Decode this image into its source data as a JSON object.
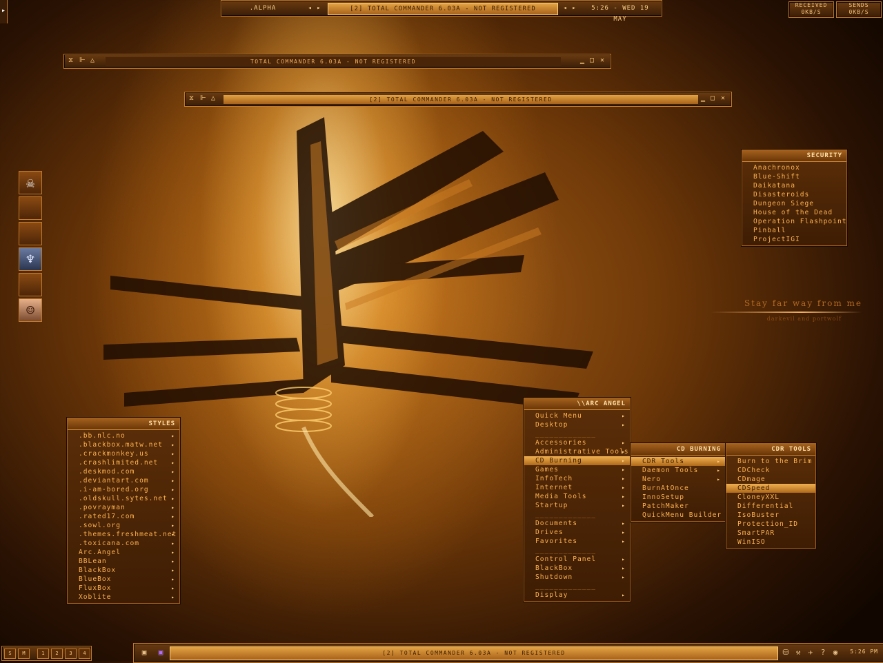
{
  "top_bar": {
    "workspace": ".ALPHA",
    "nav_prev": "◂ ▸",
    "window_title": "[2] TOTAL COMMANDER 6.03A - NOT REGISTERED",
    "nav_next": "◂ ▸",
    "clock": "5:26 - WED 19 MAY"
  },
  "net_monitor": {
    "received_label": "RECEIVED",
    "received_value": "0KB/S",
    "sends_label": "SENDS",
    "sends_value": "0KB/S"
  },
  "windows": [
    {
      "title": "TOTAL COMMANDER 6.03A - NOT REGISTERED"
    },
    {
      "title": "[2] TOTAL COMMANDER 6.03A - NOT REGISTERED"
    }
  ],
  "icon_bar": {
    "icons": [
      "skull-icon",
      "empty-slot",
      "empty-slot",
      "mask-icon",
      "empty-slot",
      "portrait-icon"
    ]
  },
  "security_menu": {
    "title": "SECURITY",
    "items": [
      "Anachronox",
      "Blue-Shift",
      "Daikatana",
      "Disasteroids",
      "Dungeon Siege",
      "House of the Dead",
      "Operation Flashpoint",
      "Pinball",
      "ProjectIGI"
    ]
  },
  "quote": {
    "line1": "Stay far way from me",
    "line2": "darkevil and portwolf"
  },
  "styles_menu": {
    "title": "STYLES",
    "items": [
      ".bb.nlc.no",
      ".blackbox.matw.net",
      ".crackmonkey.us",
      ".crashlimited.net",
      ".deskmod.com",
      ".deviantart.com",
      ".i-am-bored.org",
      ".oldskull.sytes.net",
      ".povrayman",
      ".rated17.com",
      ".sowl.org",
      ".themes.freshmeat.net",
      ".toxicana.com",
      "Arc.Angel",
      "BBLean",
      "BlackBox",
      "BlueBox",
      "FluxBox",
      "Xoblite"
    ]
  },
  "arc_menu": {
    "title": "\\\\ARC ANGEL",
    "items": [
      {
        "label": "Quick Menu",
        "sub": true
      },
      {
        "label": "Desktop",
        "sub": true
      },
      {
        "label": "_____________",
        "sep": true
      },
      {
        "label": "Accessories",
        "sub": true
      },
      {
        "label": "Administrative Tools",
        "sub": true
      },
      {
        "label": "CD Burning",
        "sub": true,
        "selected": true
      },
      {
        "label": "Games",
        "sub": true
      },
      {
        "label": "InfoTech",
        "sub": true
      },
      {
        "label": "Internet",
        "sub": true
      },
      {
        "label": "Media Tools",
        "sub": true
      },
      {
        "label": "Startup",
        "sub": true
      },
      {
        "label": "_____________",
        "sep": true
      },
      {
        "label": "Documents",
        "sub": true
      },
      {
        "label": "Drives",
        "sub": true
      },
      {
        "label": "Favorites",
        "sub": true
      },
      {
        "label": "_____________",
        "sep": true
      },
      {
        "label": "Control Panel",
        "sub": true
      },
      {
        "label": "BlackBox",
        "sub": true
      },
      {
        "label": "Shutdown",
        "sub": true
      },
      {
        "label": "_____________",
        "sep": true
      },
      {
        "label": "Display",
        "sub": true
      }
    ]
  },
  "cd_burning_menu": {
    "title": "CD BURNING",
    "items": [
      {
        "label": "CDR Tools",
        "sub": true,
        "selected": true
      },
      {
        "label": "Daemon Tools",
        "sub": true
      },
      {
        "label": "Nero",
        "sub": true
      },
      {
        "label": "BurnAtOnce"
      },
      {
        "label": "InnoSetup"
      },
      {
        "label": "PatchMaker"
      },
      {
        "label": "QuickMenu Builder"
      }
    ]
  },
  "cdr_tools_menu": {
    "title": "CDR TOOLS",
    "items": [
      {
        "label": "Burn to the Brim"
      },
      {
        "label": "CDCheck"
      },
      {
        "label": "CDmage"
      },
      {
        "label": "CDSpeed",
        "selected": true
      },
      {
        "label": "CloneyXXL"
      },
      {
        "label": "Differential"
      },
      {
        "label": "IsoBuster"
      },
      {
        "label": "Protection_ID"
      },
      {
        "label": "SmartPAR"
      },
      {
        "label": "WinISO"
      }
    ]
  },
  "workspace_bar": {
    "buttons": [
      "S",
      "M",
      "1",
      "2",
      "3",
      "4"
    ]
  },
  "taskbar": {
    "task_title": "[2] TOTAL COMMANDER 6.03A - NOT REGISTERED",
    "clock": "5:26 PM"
  },
  "colors": {
    "accent": "#f0b050",
    "text": "#ffb24e",
    "dark": "#3e1d04",
    "border": "#c27a2a"
  }
}
